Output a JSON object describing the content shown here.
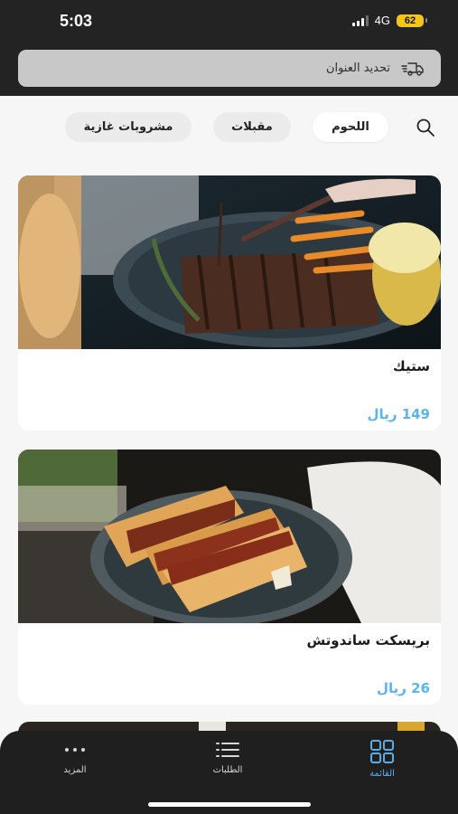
{
  "status_bar": {
    "time": "5:03",
    "network": "4G",
    "battery": "62"
  },
  "header": {
    "address_label": "تحديد العنوان",
    "address_icon": "truck-icon"
  },
  "categories": {
    "search_icon": "search-icon",
    "tabs": [
      {
        "label": "اللحوم",
        "active": true
      },
      {
        "label": "مقبلات",
        "active": false
      },
      {
        "label": "مشروبات غازية",
        "active": false
      }
    ]
  },
  "products": [
    {
      "name": "ستيك",
      "price": "149 ريال"
    },
    {
      "name": "بريسكت ساندوتش",
      "price": "26 ريال"
    }
  ],
  "bottom_nav": {
    "items": [
      {
        "label": "المزيد",
        "icon": "more-dots-icon"
      },
      {
        "label": "الطلبات",
        "icon": "list-icon"
      },
      {
        "label": "القائمة",
        "icon": "grid-icon",
        "active": true
      }
    ]
  },
  "colors": {
    "accent": "#5fb3ec",
    "dark": "#232323",
    "battery": "#f5c518"
  }
}
